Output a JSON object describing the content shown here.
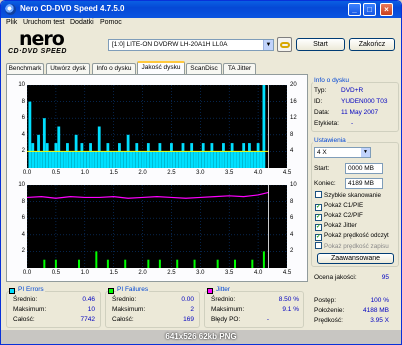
{
  "window": {
    "title": "Nero CD-DVD Speed 4.7.5.0"
  },
  "titlebar_buttons": {
    "minimize": "_",
    "maximize": "□",
    "close": "×"
  },
  "menu": [
    "Plik",
    "Uruchom test",
    "Dodatki",
    "Pomoc"
  ],
  "logo": {
    "brand": "nero",
    "product": "CD·DVD SPEED"
  },
  "drive": {
    "selected": "[1:0]   LITE-ON DVDRW LH-20A1H LL0A"
  },
  "buttons": {
    "start": "Start",
    "close": "Zakończ",
    "advanced": "Zaawansowane"
  },
  "tabs": [
    "Benchmark",
    "Utwórz dysk",
    "Info o dysku",
    "Jakość dysku",
    "ScanDisc",
    "TA Jitter"
  ],
  "active_tab": 3,
  "colors": {
    "pi_errors": "#00e0ff",
    "pi_failures": "#00ff00",
    "jitter": "#ff00ff",
    "speed": "#ffff00",
    "chart_bg": "#000000",
    "accent": "#0046d5"
  },
  "disc_info": {
    "title": "Info o dysku",
    "type_label": "Typ:",
    "type_value": "DVD+R",
    "id_label": "ID:",
    "id_value": "YUDEN000 T03",
    "date_label": "Data:",
    "date_value": "11 May 2007",
    "tag_label": "Etykieta:",
    "tag_value": "-"
  },
  "settings": {
    "title": "Ustawienia",
    "speed": "4 X",
    "start_label": "Start:",
    "start_value": "0000 MB",
    "end_label": "Koniec:",
    "end_value": "4189 MB",
    "options": [
      {
        "label": "Szybkie skanowanie",
        "checked": false
      },
      {
        "label": "Pokaż C1/PIE",
        "checked": true
      },
      {
        "label": "Pokaż C2/PIF",
        "checked": true
      },
      {
        "label": "Pokaż Jitter",
        "checked": true
      },
      {
        "label": "Pokaż prędkość odczyt",
        "checked": true
      },
      {
        "label": "Pokaż prędkość zapisu",
        "checked": false
      }
    ]
  },
  "quality": {
    "label": "Ocena jakości:",
    "value": "95"
  },
  "pi_errors": {
    "title": "PI Errors",
    "avg_label": "Średnio:",
    "avg": "0.46",
    "max_label": "Maksimum:",
    "max": "10",
    "total_label": "Całość:",
    "total": "7742"
  },
  "pi_failures": {
    "title": "PI Failures",
    "avg_label": "Średnio:",
    "avg": "0.00",
    "max_label": "Maksimum:",
    "max": "2",
    "total_label": "Całość:",
    "total": "169"
  },
  "jitter": {
    "title": "Jitter",
    "avg_label": "Średnio:",
    "avg": "8.50 %",
    "max_label": "Maksimum:",
    "max": "9.1 %",
    "po_label": "Błędy PO:",
    "po": "-"
  },
  "progress": {
    "progress_label": "Postęp:",
    "progress_value": "100 %",
    "position_label": "Położenie:",
    "position_value": "4188 MB",
    "speed_label": "Prędkość:",
    "speed_value": "3.95 X"
  },
  "statusbar": {
    "caption": "641x526 62kb PNG"
  },
  "chart_data": [
    {
      "type": "bar",
      "name_hint": "PI Errors chart",
      "x_ticks": [
        "0.0",
        "0.5",
        "1.0",
        "1.5",
        "2.0",
        "2.5",
        "3.0",
        "3.5",
        "4.0",
        "4.5"
      ],
      "y_ticks_left": [
        "10",
        "8",
        "6",
        "4",
        "2"
      ],
      "y_ticks_right": [
        "20",
        "16",
        "12",
        "8",
        "4"
      ],
      "xlim": [
        0,
        4.5
      ],
      "ylim": [
        0,
        10
      ],
      "y2lim": [
        0,
        20
      ],
      "x_positions": [
        0.05,
        0.1,
        0.15,
        0.2,
        0.25,
        0.3,
        0.35,
        0.4,
        0.45,
        0.5,
        0.55,
        0.6,
        0.65,
        0.7,
        0.75,
        0.8,
        0.85,
        0.9,
        0.95,
        1.0,
        1.05,
        1.1,
        1.15,
        1.2,
        1.25,
        1.3,
        1.35,
        1.4,
        1.45,
        1.5,
        1.55,
        1.6,
        1.65,
        1.7,
        1.75,
        1.8,
        1.85,
        1.9,
        1.95,
        2.0,
        2.05,
        2.1,
        2.15,
        2.2,
        2.25,
        2.3,
        2.35,
        2.4,
        2.45,
        2.5,
        2.55,
        2.6,
        2.65,
        2.7,
        2.75,
        2.8,
        2.85,
        2.9,
        2.95,
        3.0,
        3.05,
        3.1,
        3.15,
        3.2,
        3.25,
        3.3,
        3.35,
        3.4,
        3.45,
        3.5,
        3.55,
        3.6,
        3.65,
        3.7,
        3.75,
        3.8,
        3.85,
        3.9,
        3.95,
        4.0,
        4.05,
        4.1
      ],
      "values": [
        8,
        3,
        2,
        4,
        2,
        6,
        3,
        2,
        2,
        3,
        5,
        2,
        2,
        3,
        2,
        2,
        4,
        2,
        3,
        2,
        2,
        3,
        2,
        2,
        5,
        2,
        2,
        3,
        2,
        2,
        2,
        3,
        2,
        2,
        4,
        2,
        2,
        3,
        2,
        2,
        2,
        3,
        2,
        2,
        2,
        3,
        2,
        2,
        2,
        3,
        2,
        2,
        2,
        3,
        2,
        2,
        3,
        2,
        2,
        2,
        3,
        2,
        2,
        3,
        2,
        2,
        2,
        3,
        2,
        2,
        3,
        2,
        2,
        2,
        3,
        2,
        3,
        2,
        2,
        3,
        2,
        10
      ],
      "speed_line": [
        [
          0,
          4
        ],
        [
          0.3,
          4
        ],
        [
          4.18,
          4
        ]
      ]
    },
    {
      "type": "line",
      "name_hint": "PI Failures and Jitter chart",
      "x_ticks": [
        "0.0",
        "0.5",
        "1.0",
        "1.5",
        "2.0",
        "2.5",
        "3.0",
        "3.5",
        "4.0",
        "4.5"
      ],
      "y_ticks_left": [
        "10",
        "8",
        "6",
        "4",
        "2"
      ],
      "y_ticks_right": [
        "10",
        "8",
        "6",
        "4",
        "2"
      ],
      "xlim": [
        0,
        4.5
      ],
      "ylim": [
        0,
        10
      ],
      "y2lim": [
        0,
        10
      ],
      "jitter": [
        [
          0,
          8.5
        ],
        [
          0.25,
          8.6
        ],
        [
          0.5,
          8.4
        ],
        [
          0.75,
          8.6
        ],
        [
          1.0,
          8.5
        ],
        [
          1.25,
          8.5
        ],
        [
          1.5,
          8.6
        ],
        [
          1.75,
          8.4
        ],
        [
          2.0,
          8.5
        ],
        [
          2.25,
          8.6
        ],
        [
          2.5,
          8.5
        ],
        [
          2.75,
          8.4
        ],
        [
          3.0,
          8.5
        ],
        [
          3.25,
          8.6
        ],
        [
          3.5,
          8.7
        ],
        [
          3.75,
          8.6
        ],
        [
          4.0,
          8.8
        ],
        [
          4.18,
          9.1
        ]
      ],
      "pif_x": [
        0.3,
        0.5,
        0.9,
        1.2,
        1.4,
        1.7,
        2.1,
        2.3,
        2.6,
        2.9,
        3.3,
        3.6,
        3.9,
        4.1
      ],
      "pif_values": [
        1,
        1,
        1,
        2,
        1,
        1,
        1,
        1,
        1,
        1,
        1,
        1,
        1,
        2
      ]
    }
  ]
}
